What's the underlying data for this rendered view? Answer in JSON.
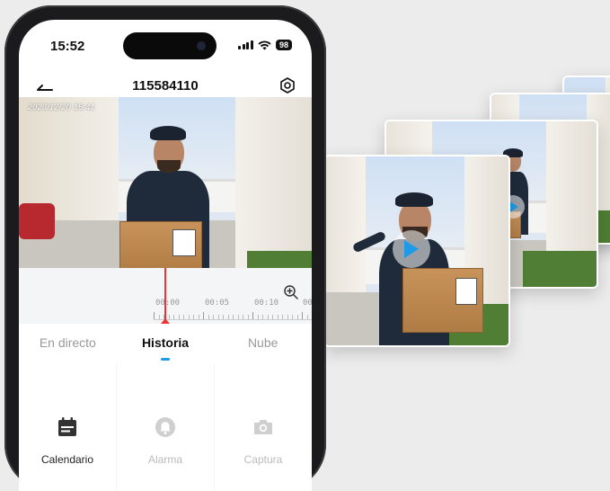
{
  "status_bar": {
    "time": "15:52",
    "battery": "98"
  },
  "header": {
    "title": "115584110"
  },
  "video": {
    "timestamp": "2023/12/20 15:41"
  },
  "timeline": {
    "labels": [
      "00:00",
      "00:05",
      "00:10",
      "00"
    ]
  },
  "tabs": [
    {
      "label": "En directo"
    },
    {
      "label": "Historia",
      "active": true
    },
    {
      "label": "Nube"
    }
  ],
  "actions": [
    {
      "label": "Calendario",
      "icon": "calendar-icon",
      "active": true
    },
    {
      "label": "Alarma",
      "icon": "bell-icon"
    },
    {
      "label": "Captura",
      "icon": "camera-icon"
    }
  ],
  "colors": {
    "accent": "#1e9be6",
    "cursor": "#e33333"
  }
}
